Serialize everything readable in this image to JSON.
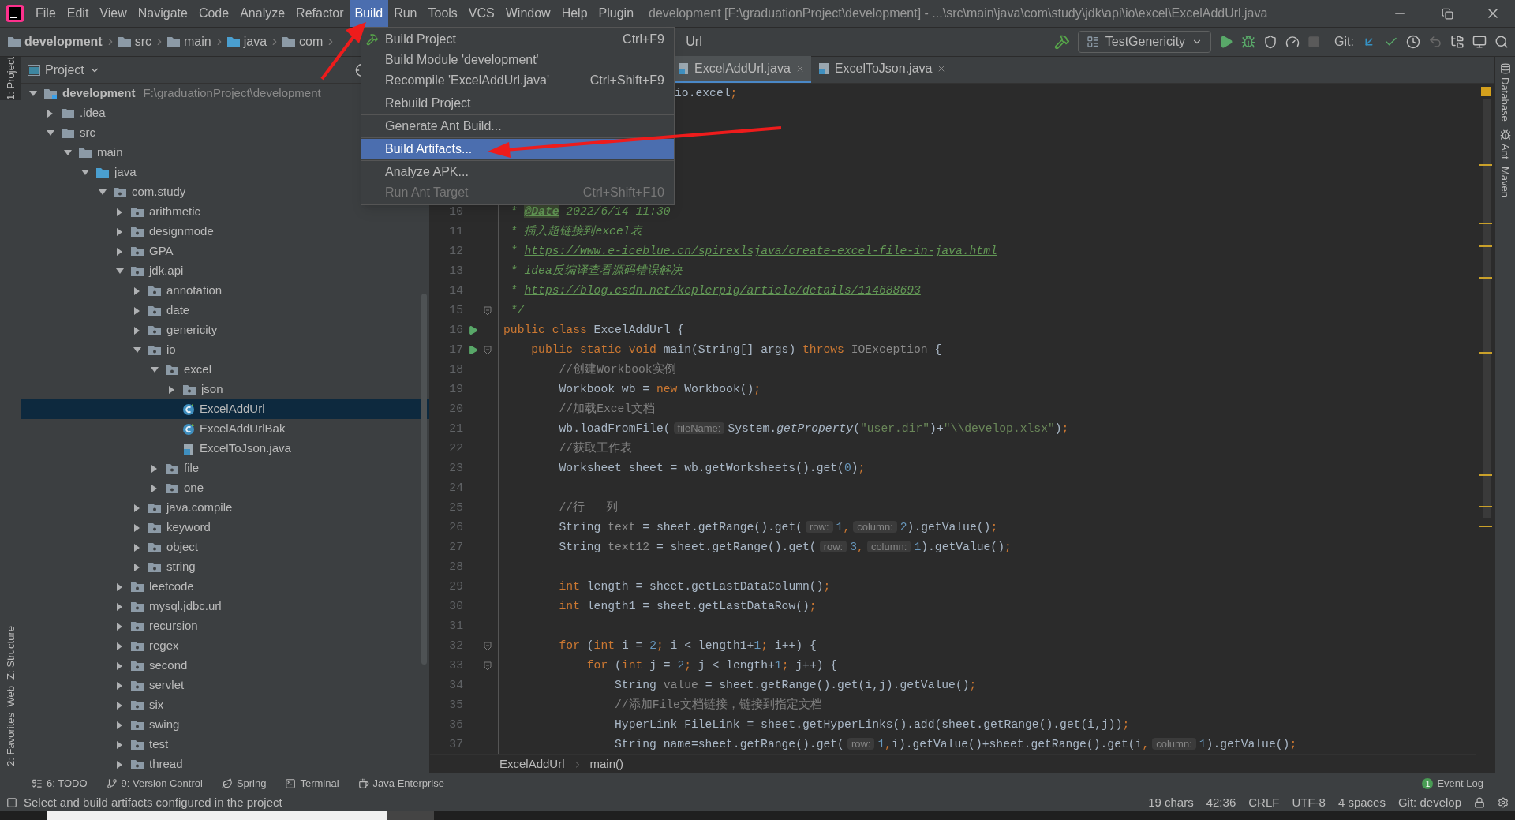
{
  "window": {
    "title": "development [F:\\graduationProject\\development] - ...\\src\\main\\java\\com\\study\\jdk\\api\\io\\excel\\ExcelAddUrl.java"
  },
  "menu_bar": [
    {
      "label": "File",
      "selected": false
    },
    {
      "label": "Edit",
      "selected": false
    },
    {
      "label": "View",
      "selected": false
    },
    {
      "label": "Navigate",
      "selected": false
    },
    {
      "label": "Code",
      "selected": false
    },
    {
      "label": "Analyze",
      "selected": false
    },
    {
      "label": "Refactor",
      "selected": false
    },
    {
      "label": "Build",
      "selected": true
    },
    {
      "label": "Run",
      "selected": false
    },
    {
      "label": "Tools",
      "selected": false
    },
    {
      "label": "VCS",
      "selected": false
    },
    {
      "label": "Window",
      "selected": false
    },
    {
      "label": "Help",
      "selected": false
    },
    {
      "label": "Plugin",
      "selected": false
    }
  ],
  "build_menu": [
    {
      "kind": "icon_item",
      "label": "Build Project",
      "shortcut": "Ctrl+F9",
      "selected": false,
      "disabled": false
    },
    {
      "kind": "item",
      "label": "Build Module 'development'",
      "selected": false,
      "disabled": false
    },
    {
      "kind": "item",
      "label": "Recompile 'ExcelAddUrl.java'",
      "shortcut": "Ctrl+Shift+F9",
      "selected": false,
      "disabled": false
    },
    {
      "kind": "separator"
    },
    {
      "kind": "item",
      "label": "Rebuild Project",
      "selected": false,
      "disabled": false
    },
    {
      "kind": "separator"
    },
    {
      "kind": "item",
      "label": "Generate Ant Build...",
      "selected": false,
      "disabled": false
    },
    {
      "kind": "separator"
    },
    {
      "kind": "item",
      "label": "Build Artifacts...",
      "selected": true,
      "disabled": false
    },
    {
      "kind": "separator"
    },
    {
      "kind": "item",
      "label": "Analyze APK...",
      "selected": false,
      "disabled": false
    },
    {
      "kind": "item",
      "label": "Run Ant Target",
      "shortcut": "Ctrl+Shift+F10",
      "selected": false,
      "disabled": true
    }
  ],
  "nav_bar": {
    "crumbs": [
      "development",
      "src",
      "main",
      "java",
      "com"
    ],
    "tail": "Url"
  },
  "toolbar": {
    "run_config": "TestGenericity",
    "git_label": "Git:"
  },
  "left_tools": [
    {
      "label": "1: Project",
      "selected": true
    },
    {
      "label": "Z: Structure",
      "selected": false
    },
    {
      "label": "Web",
      "selected": false
    },
    {
      "label": "2: Favorites",
      "selected": false
    }
  ],
  "right_tools": [
    "Database",
    "Ant",
    "Maven"
  ],
  "project_panel": {
    "title": "Project",
    "tree": [
      {
        "name": "development",
        "path": "F:\\graduationProject\\development",
        "kind": "module",
        "expanded": true,
        "selected": false,
        "children": [
          {
            "name": ".idea",
            "kind": "folder",
            "expanded": false,
            "selected": false
          },
          {
            "name": "src",
            "kind": "folder",
            "expanded": true,
            "selected": false,
            "children": [
              {
                "name": "main",
                "kind": "folder",
                "expanded": true,
                "selected": false,
                "children": [
                  {
                    "name": "java",
                    "kind": "source",
                    "expanded": true,
                    "selected": false,
                    "children": [
                      {
                        "name": "com.study",
                        "kind": "package",
                        "expanded": true,
                        "selected": false,
                        "children": [
                          {
                            "name": "arithmetic",
                            "kind": "package",
                            "expanded": false,
                            "selected": false
                          },
                          {
                            "name": "designmode",
                            "kind": "package",
                            "expanded": false,
                            "selected": false
                          },
                          {
                            "name": "GPA",
                            "kind": "package",
                            "expanded": false,
                            "selected": false
                          },
                          {
                            "name": "jdk.api",
                            "kind": "package",
                            "expanded": true,
                            "selected": false,
                            "children": [
                              {
                                "name": "annotation",
                                "kind": "package",
                                "expanded": false,
                                "selected": false
                              },
                              {
                                "name": "date",
                                "kind": "package",
                                "expanded": false,
                                "selected": false
                              },
                              {
                                "name": "genericity",
                                "kind": "package",
                                "expanded": false,
                                "selected": false
                              },
                              {
                                "name": "io",
                                "kind": "package",
                                "expanded": true,
                                "selected": false,
                                "children": [
                                  {
                                    "name": "excel",
                                    "kind": "package",
                                    "expanded": true,
                                    "selected": false,
                                    "children": [
                                      {
                                        "name": "json",
                                        "kind": "package",
                                        "expanded": false,
                                        "selected": false
                                      },
                                      {
                                        "name": "ExcelAddUrl",
                                        "kind": "class",
                                        "selected": true
                                      },
                                      {
                                        "name": "ExcelAddUrlBak",
                                        "kind": "class",
                                        "selected": false
                                      },
                                      {
                                        "name": "ExcelToJson.java",
                                        "kind": "java_file",
                                        "selected": false
                                      }
                                    ]
                                  },
                                  {
                                    "name": "file",
                                    "kind": "package",
                                    "expanded": false,
                                    "selected": false
                                  },
                                  {
                                    "name": "one",
                                    "kind": "package",
                                    "expanded": false,
                                    "selected": false
                                  }
                                ]
                              },
                              {
                                "name": "java.compile",
                                "kind": "package",
                                "expanded": false,
                                "selected": false
                              },
                              {
                                "name": "keyword",
                                "kind": "package",
                                "expanded": false,
                                "selected": false
                              },
                              {
                                "name": "object",
                                "kind": "package",
                                "expanded": false,
                                "selected": false
                              },
                              {
                                "name": "string",
                                "kind": "package",
                                "expanded": false,
                                "selected": false
                              }
                            ]
                          },
                          {
                            "name": "leetcode",
                            "kind": "package",
                            "expanded": false,
                            "selected": false
                          },
                          {
                            "name": "mysql.jdbc.url",
                            "kind": "package",
                            "expanded": false,
                            "selected": false
                          },
                          {
                            "name": "recursion",
                            "kind": "package",
                            "expanded": false,
                            "selected": false
                          },
                          {
                            "name": "regex",
                            "kind": "package",
                            "expanded": false,
                            "selected": false
                          },
                          {
                            "name": "second",
                            "kind": "package",
                            "expanded": false,
                            "selected": false
                          },
                          {
                            "name": "servlet",
                            "kind": "package",
                            "expanded": false,
                            "selected": false
                          },
                          {
                            "name": "six",
                            "kind": "package",
                            "expanded": false,
                            "selected": false
                          },
                          {
                            "name": "swing",
                            "kind": "package",
                            "expanded": false,
                            "selected": false
                          },
                          {
                            "name": "test",
                            "kind": "package",
                            "expanded": false,
                            "selected": false
                          },
                          {
                            "name": "thread",
                            "kind": "package",
                            "expanded": false,
                            "selected": false
                          }
                        ]
                      }
                    ]
                  }
                ]
              }
            ]
          }
        ]
      }
    ]
  },
  "editor": {
    "tabs": [
      {
        "label": "ExcelAddUrl.java",
        "selected": true
      },
      {
        "label": "ExcelToJson.java",
        "selected": false
      }
    ],
    "top_fragment": [
      {
        "kind": "plain",
        "text": "io.excel"
      },
      {
        "kind": "kw",
        "text": ";"
      }
    ],
    "lines": [
      {
        "number": "10",
        "segments": [
          {
            "kind": "doc",
            "text": " * "
          },
          {
            "kind": "tag",
            "text": "@Date"
          },
          {
            "kind": "doc",
            "text": " 2022/6/14 11:30"
          }
        ]
      },
      {
        "number": "11",
        "segments": [
          {
            "kind": "doc",
            "text": " * 插入超链接到excel表"
          }
        ]
      },
      {
        "number": "12",
        "segments": [
          {
            "kind": "doc",
            "text": " * "
          },
          {
            "kind": "link",
            "text": "https://www.e-iceblue.cn/spirexlsjava/create-excel-file-in-java.html"
          }
        ]
      },
      {
        "number": "13",
        "segments": [
          {
            "kind": "doc",
            "text": " * idea反编译查看源码错误解决"
          }
        ]
      },
      {
        "number": "14",
        "segments": [
          {
            "kind": "doc",
            "text": " * "
          },
          {
            "kind": "link",
            "text": "https://blog.csdn.net/keplerpig/article/details/114688693"
          }
        ]
      },
      {
        "number": "15",
        "fold": true,
        "segments": [
          {
            "kind": "doc",
            "text": " */"
          }
        ]
      },
      {
        "number": "16",
        "run": true,
        "segments": [
          {
            "kind": "kw",
            "text": "public class "
          },
          {
            "kind": "plain",
            "text": "ExcelAddUrl {"
          }
        ]
      },
      {
        "number": "17",
        "run": true,
        "fold": true,
        "segments": [
          {
            "kind": "kw",
            "text": "    public static void "
          },
          {
            "kind": "plain",
            "text": "main(String[] args) "
          },
          {
            "kind": "kw",
            "text": "throws "
          },
          {
            "kind": "gray",
            "text": "IOException"
          },
          {
            "kind": "plain",
            "text": " {"
          }
        ]
      },
      {
        "number": "18",
        "segments": [
          {
            "kind": "cmt",
            "text": "        //创建Workbook实例"
          }
        ]
      },
      {
        "number": "19",
        "segments": [
          {
            "kind": "plain",
            "text": "        Workbook wb = "
          },
          {
            "kind": "kw",
            "text": "new "
          },
          {
            "kind": "plain",
            "text": "Workbook()"
          },
          {
            "kind": "kw",
            "text": ";"
          }
        ]
      },
      {
        "number": "20",
        "segments": [
          {
            "kind": "cmt",
            "text": "        //加载Excel文档"
          }
        ]
      },
      {
        "number": "21",
        "segments": [
          {
            "kind": "plain",
            "text": "        wb.loadFromFile("
          },
          {
            "kind": "hint",
            "text": "fileName:"
          },
          {
            "kind": "plain",
            "text": "System."
          },
          {
            "kind": "italic",
            "text": "getProperty"
          },
          {
            "kind": "plain",
            "text": "("
          },
          {
            "kind": "str",
            "text": "\"user.dir\""
          },
          {
            "kind": "plain",
            "text": ")+"
          },
          {
            "kind": "str",
            "text": "\"\\\\develop.xlsx\""
          },
          {
            "kind": "plain",
            "text": ")"
          },
          {
            "kind": "kw",
            "text": ";"
          }
        ]
      },
      {
        "number": "22",
        "segments": [
          {
            "kind": "cmt",
            "text": "        //获取工作表"
          }
        ]
      },
      {
        "number": "23",
        "segments": [
          {
            "kind": "plain",
            "text": "        Worksheet sheet = wb.getWorksheets().get("
          },
          {
            "kind": "num",
            "text": "0"
          },
          {
            "kind": "plain",
            "text": ")"
          },
          {
            "kind": "kw",
            "text": ";"
          }
        ]
      },
      {
        "number": "24"
      },
      {
        "number": "25",
        "segments": [
          {
            "kind": "cmt",
            "text": "        //行   列"
          }
        ]
      },
      {
        "number": "26",
        "segments": [
          {
            "kind": "plain",
            "text": "        String "
          },
          {
            "kind": "gray",
            "text": "text"
          },
          {
            "kind": "plain",
            "text": " = sheet.getRange().get("
          },
          {
            "kind": "hint",
            "text": "row:"
          },
          {
            "kind": "num",
            "text": "1"
          },
          {
            "kind": "kw",
            "text": ","
          },
          {
            "kind": "hint",
            "text": "column:"
          },
          {
            "kind": "num",
            "text": "2"
          },
          {
            "kind": "plain",
            "text": ").getValue()"
          },
          {
            "kind": "kw",
            "text": ";"
          }
        ]
      },
      {
        "number": "27",
        "segments": [
          {
            "kind": "plain",
            "text": "        String "
          },
          {
            "kind": "gray",
            "text": "text12"
          },
          {
            "kind": "plain",
            "text": " = sheet.getRange().get("
          },
          {
            "kind": "hint",
            "text": "row:"
          },
          {
            "kind": "num",
            "text": "3"
          },
          {
            "kind": "kw",
            "text": ","
          },
          {
            "kind": "hint",
            "text": "column:"
          },
          {
            "kind": "num",
            "text": "1"
          },
          {
            "kind": "plain",
            "text": ").getValue()"
          },
          {
            "kind": "kw",
            "text": ";"
          }
        ]
      },
      {
        "number": "28"
      },
      {
        "number": "29",
        "segments": [
          {
            "kind": "kw",
            "text": "        int "
          },
          {
            "kind": "plain",
            "text": "length = sheet.getLastDataColumn()"
          },
          {
            "kind": "kw",
            "text": ";"
          }
        ]
      },
      {
        "number": "30",
        "segments": [
          {
            "kind": "kw",
            "text": "        int "
          },
          {
            "kind": "plain",
            "text": "length1 = sheet.getLastDataRow()"
          },
          {
            "kind": "kw",
            "text": ";"
          }
        ]
      },
      {
        "number": "31"
      },
      {
        "number": "32",
        "fold": true,
        "segments": [
          {
            "kind": "kw",
            "text": "        for "
          },
          {
            "kind": "plain",
            "text": "("
          },
          {
            "kind": "kw",
            "text": "int "
          },
          {
            "kind": "plain",
            "text": "i = "
          },
          {
            "kind": "num",
            "text": "2"
          },
          {
            "kind": "kw",
            "text": "; "
          },
          {
            "kind": "plain",
            "text": "i < length1+"
          },
          {
            "kind": "num",
            "text": "1"
          },
          {
            "kind": "kw",
            "text": "; "
          },
          {
            "kind": "plain",
            "text": "i++) {"
          }
        ]
      },
      {
        "number": "33",
        "fold": true,
        "segments": [
          {
            "kind": "kw",
            "text": "            for "
          },
          {
            "kind": "plain",
            "text": "("
          },
          {
            "kind": "kw",
            "text": "int "
          },
          {
            "kind": "plain",
            "text": "j = "
          },
          {
            "kind": "num",
            "text": "2"
          },
          {
            "kind": "kw",
            "text": "; "
          },
          {
            "kind": "plain",
            "text": "j < length+"
          },
          {
            "kind": "num",
            "text": "1"
          },
          {
            "kind": "kw",
            "text": "; "
          },
          {
            "kind": "plain",
            "text": "j++) {"
          }
        ]
      },
      {
        "number": "34",
        "segments": [
          {
            "kind": "plain",
            "text": "                String "
          },
          {
            "kind": "gray",
            "text": "value"
          },
          {
            "kind": "plain",
            "text": " = sheet.getRange().get(i,j).getValue()"
          },
          {
            "kind": "kw",
            "text": ";"
          }
        ]
      },
      {
        "number": "35",
        "segments": [
          {
            "kind": "cmt",
            "text": "                //添加File文档链接，链接到指定文档"
          }
        ]
      },
      {
        "number": "36",
        "segments": [
          {
            "kind": "plain",
            "text": "                HyperLink FileLink = sheet.getHyperLinks().add(sheet.getRange().get(i,j))"
          },
          {
            "kind": "kw",
            "text": ";"
          }
        ]
      },
      {
        "number": "37",
        "segments": [
          {
            "kind": "plain",
            "text": "                String name=sheet.getRange().get("
          },
          {
            "kind": "hint",
            "text": "row:"
          },
          {
            "kind": "num",
            "text": "1"
          },
          {
            "kind": "kw",
            "text": ","
          },
          {
            "kind": "plain",
            "text": "i).getValue()+sheet.getRange().get(i"
          },
          {
            "kind": "kw",
            "text": ","
          },
          {
            "kind": "hint",
            "text": "column:"
          },
          {
            "kind": "num",
            "text": "1"
          },
          {
            "kind": "plain",
            "text": ").getValue()"
          },
          {
            "kind": "kw",
            "text": ";"
          }
        ]
      }
    ],
    "breadcrumb": [
      "ExcelAddUrl",
      "main()"
    ]
  },
  "bottom_tools": [
    "6: TODO",
    "9: Version Control",
    "Spring",
    "Terminal",
    "Java Enterprise"
  ],
  "event_log": {
    "label": "Event Log",
    "count": "1"
  },
  "status_bar": {
    "message": "Select and build artifacts configured in the project",
    "items": [
      "19 chars",
      "42:36",
      "CRLF",
      "UTF-8",
      "4 spaces",
      "Git: develop"
    ]
  }
}
